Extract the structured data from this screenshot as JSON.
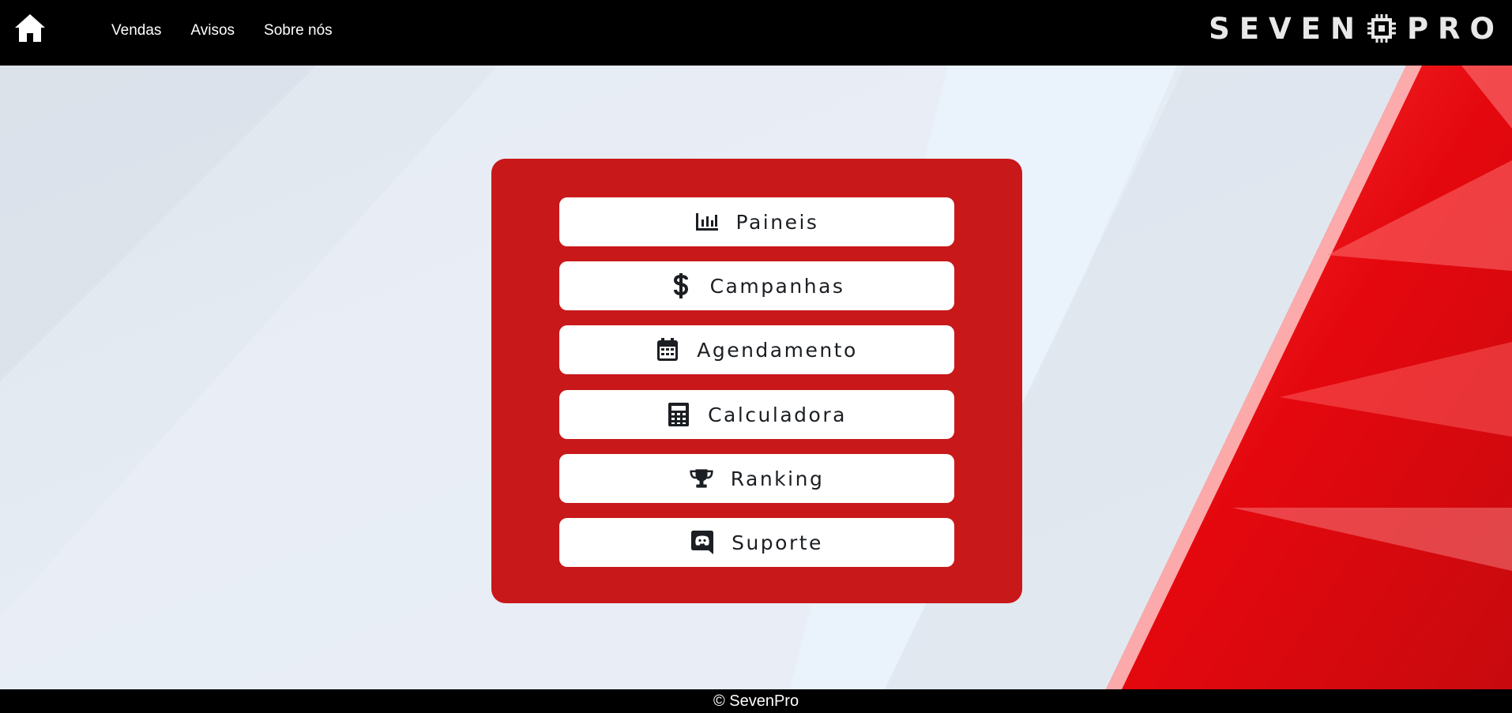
{
  "header": {
    "home_icon": "home-icon",
    "nav": [
      "Vendas",
      "Avisos",
      "Sobre nós"
    ],
    "brand": {
      "left": "SEVEN",
      "right": "PRO",
      "chip_icon": "chip-icon"
    }
  },
  "menu": [
    {
      "label": "Paineis",
      "icon": "bar-chart-icon"
    },
    {
      "label": "Campanhas",
      "icon": "dollar-icon"
    },
    {
      "label": "Agendamento",
      "icon": "calendar-icon"
    },
    {
      "label": "Calculadora",
      "icon": "calculator-icon"
    },
    {
      "label": "Ranking",
      "icon": "trophy-icon"
    },
    {
      "label": "Suporte",
      "icon": "discord-icon"
    }
  ],
  "footer": {
    "text": "© SevenPro"
  },
  "colors": {
    "panel": "#c8181a",
    "topbar": "#000000",
    "accent_red": "#e01015"
  }
}
